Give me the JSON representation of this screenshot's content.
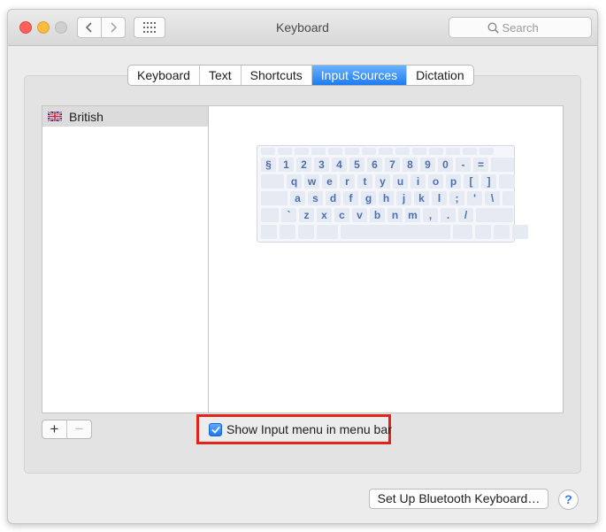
{
  "window": {
    "title": "Keyboard"
  },
  "search": {
    "placeholder": "Search"
  },
  "tabs": [
    {
      "label": "Keyboard"
    },
    {
      "label": "Text"
    },
    {
      "label": "Shortcuts"
    },
    {
      "label": "Input Sources",
      "active": true
    },
    {
      "label": "Dictation"
    }
  ],
  "sources": [
    {
      "label": "British",
      "flag": "uk-flag-icon",
      "selected": true
    }
  ],
  "keyboard_rows": [
    [
      "§",
      "1",
      "2",
      "3",
      "4",
      "5",
      "6",
      "7",
      "8",
      "9",
      "0",
      "-",
      "="
    ],
    [
      "q",
      "w",
      "e",
      "r",
      "t",
      "y",
      "u",
      "i",
      "o",
      "p",
      "[",
      "]"
    ],
    [
      "a",
      "s",
      "d",
      "f",
      "g",
      "h",
      "j",
      "k",
      "l",
      ";",
      "'",
      "\\"
    ],
    [
      "`",
      "z",
      "x",
      "c",
      "v",
      "b",
      "n",
      "m",
      ",",
      ".",
      "/"
    ]
  ],
  "controls": {
    "add_label": "+",
    "remove_label": "−"
  },
  "checkbox": {
    "label": "Show Input menu in menu bar",
    "checked": true
  },
  "bluetooth_button": "Set Up Bluetooth Keyboard…",
  "help_label": "?",
  "colors": {
    "accent": "#1d7cf2",
    "highlight": "#e2231a"
  }
}
